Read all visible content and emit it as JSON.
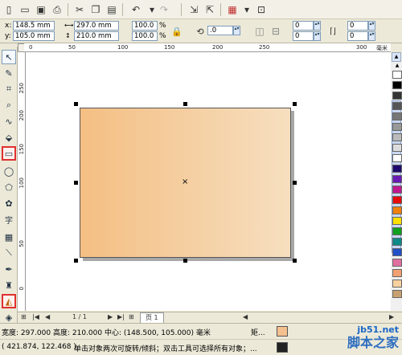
{
  "toolbar": {
    "icons": [
      "new-icon",
      "open-icon",
      "save-icon",
      "print-icon",
      "cut-icon",
      "copy-icon",
      "paste-icon",
      "undo-icon",
      "redo-icon",
      "import-icon",
      "export-icon",
      "app-launcher-icon",
      "welcome-icon"
    ]
  },
  "props": {
    "x_label": "x:",
    "x_value": "148.5 mm",
    "y_label": "y:",
    "y_value": "105.0 mm",
    "width_value": "297.0 mm",
    "height_value": "210.0 mm",
    "scale_x": "100.0",
    "scale_y": "100.0",
    "percent": "%",
    "rotation": ".0",
    "corner_tl": "0",
    "corner_bl": "0",
    "corner_tr": "0",
    "corner_br": "0"
  },
  "ruler": {
    "top_ticks": [
      "0",
      "50",
      "100",
      "150",
      "200",
      "250",
      "300",
      "毫米"
    ],
    "left_ticks": [
      "250",
      "200",
      "150",
      "100",
      "50",
      "0"
    ]
  },
  "pages": {
    "counter": "1 / 1",
    "tab": "页 1"
  },
  "status": {
    "line1": "宽度: 297.000  高度: 210.000  中心: (148.500, 105.000)  毫米",
    "line1_right": "矩...",
    "line2": "( 421.874, 122.468 )",
    "line2_hint": "单击对象两次可旋转/倾斜；双击工具可选择所有对象；..."
  },
  "palette": {
    "colors": [
      "#ffffff",
      "#000000",
      "#333333",
      "#555555",
      "#777777",
      "#999999",
      "#bbbbbb",
      "#dddddd",
      "#ffffff",
      "#1e0a6e",
      "#6a1bb5",
      "#c01890",
      "#e60c0c",
      "#f08010",
      "#ffe000",
      "#10a020",
      "#0d8a8a",
      "#2050c8",
      "#e070a0",
      "#f0a070",
      "#f8d0a0",
      "#c8a070"
    ]
  },
  "watermark": {
    "site": "jb51.net",
    "name": "脚本之家"
  },
  "colors": {
    "gradient_start": "#f4bf83",
    "gradient_end": "#f6dfbf"
  }
}
